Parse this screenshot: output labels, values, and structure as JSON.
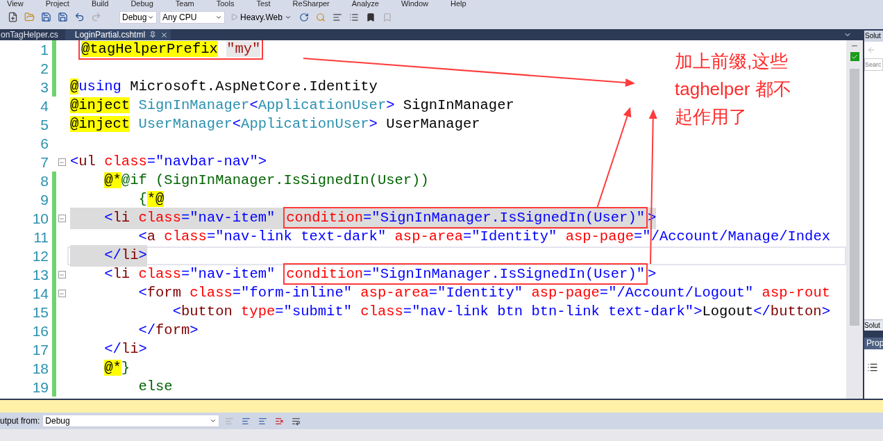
{
  "menu": [
    "View",
    "Project",
    "Build",
    "Debug",
    "Team",
    "Tools",
    "Test",
    "ReSharper",
    "Analyze",
    "Window",
    "Help"
  ],
  "toolbar": {
    "configuration": "Debug",
    "platform": "Any CPU",
    "start_target": "Heavy.Web"
  },
  "tabs": [
    {
      "label": "onTagHelper.cs",
      "selected": false
    },
    {
      "label": "LoginPartial.cshtml",
      "selected": true
    }
  ],
  "editor": {
    "lines": [
      {
        "number": "1",
        "changed": true,
        "foldable": false,
        "tag_match": false,
        "current": false,
        "segments": [
          {
            "kind": "box",
            "tokens": [
              {
                "kind": "razor",
                "text": "@tagHelperPrefix"
              },
              {
                "kind": "literal",
                "text": " \"my\""
              }
            ]
          }
        ]
      },
      {
        "number": "2",
        "changed": true,
        "foldable": false,
        "current": false
      },
      {
        "number": "3",
        "changed": true,
        "foldable": false,
        "tag_match": false,
        "current": false,
        "segments": [
          {
            "kind": "razor",
            "text": "@"
          },
          {
            "kind": "keyword",
            "text": "using"
          },
          {
            "kind": "plain",
            "text": " Microsoft.AspNetCore.Identity"
          }
        ]
      },
      {
        "number": "4",
        "changed": false,
        "foldable": false,
        "tag_match": false,
        "current": false,
        "segments": [
          {
            "kind": "razor",
            "text": "@inject"
          },
          {
            "kind": "type",
            "text": " SignInManager"
          },
          {
            "kind": "delim",
            "text": "<"
          },
          {
            "kind": "type",
            "text": "ApplicationUser"
          },
          {
            "kind": "delim",
            "text": ">"
          },
          {
            "kind": "plain",
            "text": " SignInManager"
          }
        ]
      },
      {
        "number": "5",
        "changed": false,
        "foldable": false,
        "tag_match": false,
        "current": false,
        "segments": [
          {
            "kind": "razor",
            "text": "@inject"
          },
          {
            "kind": "type",
            "text": " UserManager"
          },
          {
            "kind": "delim",
            "text": "<"
          },
          {
            "kind": "type",
            "text": "ApplicationUser"
          },
          {
            "kind": "delim",
            "text": ">"
          },
          {
            "kind": "plain",
            "text": " UserManager"
          }
        ]
      },
      {
        "number": "6",
        "changed": false,
        "foldable": false,
        "current": false
      },
      {
        "number": "7",
        "changed": false,
        "foldable": true,
        "tag_match": false,
        "current": false,
        "segments": [
          {
            "kind": "delim",
            "text": "<"
          },
          {
            "kind": "tag",
            "text": "ul"
          },
          {
            "kind": "attr",
            "text": " class"
          },
          {
            "kind": "delim",
            "text": "="
          },
          {
            "kind": "string",
            "text": "\"navbar-nav\""
          },
          {
            "kind": "delim",
            "text": ">"
          }
        ]
      },
      {
        "number": "8",
        "changed": true,
        "foldable": false,
        "tag_match": false,
        "current": false,
        "segments": [
          {
            "kind": "razor",
            "text": "    @*"
          },
          {
            "kind": "comment",
            "text": "@if (SignInManager.IsSignedIn(User))"
          }
        ]
      },
      {
        "number": "9",
        "changed": true,
        "foldable": false,
        "tag_match": false,
        "current": false,
        "segments": [
          {
            "kind": "comment",
            "text": "        {"
          },
          {
            "kind": "razor",
            "text": "*@"
          }
        ]
      },
      {
        "number": "10",
        "changed": true,
        "foldable": true,
        "tag_match": true,
        "current": false,
        "segments": [
          {
            "kind": "delim",
            "text": "    <"
          },
          {
            "kind": "tag",
            "text": "li"
          },
          {
            "kind": "attr",
            "text": " class"
          },
          {
            "kind": "delim",
            "text": "="
          },
          {
            "kind": "string",
            "text": "\"nav-item\""
          },
          {
            "kind": "box",
            "tokens": [
              {
                "kind": "attr",
                "text": "condition"
              },
              {
                "kind": "delim",
                "text": "="
              },
              {
                "kind": "string",
                "text": "\"SignInManager.IsSignedIn(User)\""
              }
            ]
          },
          {
            "kind": "delim",
            "text": ">"
          }
        ]
      },
      {
        "number": "11",
        "changed": true,
        "foldable": false,
        "tag_match": false,
        "current": false,
        "segments": [
          {
            "kind": "delim",
            "text": "        <"
          },
          {
            "kind": "tag",
            "text": "a"
          },
          {
            "kind": "attr",
            "text": " class"
          },
          {
            "kind": "delim",
            "text": "="
          },
          {
            "kind": "string",
            "text": "\"nav-link text-dark\""
          },
          {
            "kind": "attr",
            "text": " asp-area"
          },
          {
            "kind": "delim",
            "text": "="
          },
          {
            "kind": "string",
            "text": "\"Identity\""
          },
          {
            "kind": "attr",
            "text": " asp-page"
          },
          {
            "kind": "delim",
            "text": "="
          },
          {
            "kind": "string",
            "text": "\"/Account/Manage/Index"
          }
        ]
      },
      {
        "number": "12",
        "changed": true,
        "foldable": false,
        "tag_match": true,
        "current": true,
        "segments": [
          {
            "kind": "delim",
            "text": "    </"
          },
          {
            "kind": "tag",
            "text": "li"
          },
          {
            "kind": "delim",
            "text": ">"
          }
        ]
      },
      {
        "number": "13",
        "changed": true,
        "foldable": true,
        "tag_match": false,
        "current": false,
        "segments": [
          {
            "kind": "delim",
            "text": "    <"
          },
          {
            "kind": "tag",
            "text": "li"
          },
          {
            "kind": "attr",
            "text": " class"
          },
          {
            "kind": "delim",
            "text": "="
          },
          {
            "kind": "string",
            "text": "\"nav-item\""
          },
          {
            "kind": "box",
            "tokens": [
              {
                "kind": "attr",
                "text": "condition"
              },
              {
                "kind": "delim",
                "text": "="
              },
              {
                "kind": "string",
                "text": "\"SignInManager.IsSignedIn(User)\""
              }
            ]
          },
          {
            "kind": "delim",
            "text": ">"
          }
        ]
      },
      {
        "number": "14",
        "changed": true,
        "foldable": true,
        "tag_match": false,
        "current": false,
        "segments": [
          {
            "kind": "delim",
            "text": "        <"
          },
          {
            "kind": "tag",
            "text": "form"
          },
          {
            "kind": "attr",
            "text": " class"
          },
          {
            "kind": "delim",
            "text": "="
          },
          {
            "kind": "string",
            "text": "\"form-inline\""
          },
          {
            "kind": "attr",
            "text": " asp-area"
          },
          {
            "kind": "delim",
            "text": "="
          },
          {
            "kind": "string",
            "text": "\"Identity\""
          },
          {
            "kind": "attr",
            "text": " asp-page"
          },
          {
            "kind": "delim",
            "text": "="
          },
          {
            "kind": "string",
            "text": "\"/Account/Logout\""
          },
          {
            "kind": "attr",
            "text": " asp-rout"
          }
        ]
      },
      {
        "number": "15",
        "changed": true,
        "foldable": false,
        "tag_match": false,
        "current": false,
        "segments": [
          {
            "kind": "delim",
            "text": "            <"
          },
          {
            "kind": "tag",
            "text": "button"
          },
          {
            "kind": "attr",
            "text": " type"
          },
          {
            "kind": "delim",
            "text": "="
          },
          {
            "kind": "string",
            "text": "\"submit\""
          },
          {
            "kind": "attr",
            "text": " class"
          },
          {
            "kind": "delim",
            "text": "="
          },
          {
            "kind": "string",
            "text": "\"nav-link btn btn-link text-dark\""
          },
          {
            "kind": "delim",
            "text": ">"
          },
          {
            "kind": "plain",
            "text": "Logout"
          },
          {
            "kind": "delim",
            "text": "</"
          },
          {
            "kind": "tag",
            "text": "button"
          },
          {
            "kind": "delim",
            "text": ">"
          }
        ]
      },
      {
        "number": "16",
        "changed": true,
        "foldable": false,
        "tag_match": false,
        "current": false,
        "segments": [
          {
            "kind": "delim",
            "text": "        </"
          },
          {
            "kind": "tag",
            "text": "form"
          },
          {
            "kind": "delim",
            "text": ">"
          }
        ]
      },
      {
        "number": "17",
        "changed": true,
        "foldable": false,
        "tag_match": false,
        "current": false,
        "segments": [
          {
            "kind": "delim",
            "text": "    </"
          },
          {
            "kind": "tag",
            "text": "li"
          },
          {
            "kind": "delim",
            "text": ">"
          }
        ]
      },
      {
        "number": "18",
        "changed": true,
        "foldable": false,
        "tag_match": false,
        "current": false,
        "segments": [
          {
            "kind": "razor",
            "text": "    @*"
          },
          {
            "kind": "comment",
            "text": "}"
          }
        ]
      },
      {
        "number": "19",
        "changed": true,
        "foldable": false,
        "tag_match": false,
        "current": false,
        "segments": [
          {
            "kind": "comment",
            "text": "        else"
          }
        ]
      }
    ]
  },
  "annotation": {
    "lines": [
      "加上前缀,这些",
      "taghelper 都不",
      "起作用了"
    ]
  },
  "solution_panel": {
    "title": "Solut",
    "search_placeholder": "Searc",
    "footer_tab": "Solut"
  },
  "properties_panel": {
    "title": "Prop"
  },
  "output": {
    "label": "utput from:",
    "source": "Debug"
  }
}
